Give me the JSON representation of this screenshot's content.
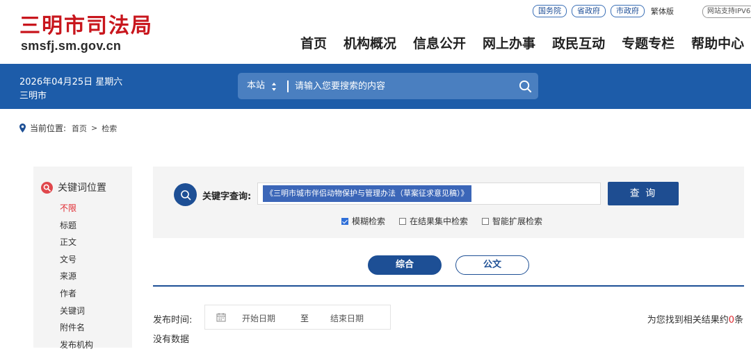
{
  "header": {
    "logo_title": "三明市司法局",
    "logo_domain": "smsfj.sm.gov.cn",
    "top_links": [
      "国务院",
      "省政府",
      "市政府"
    ],
    "traditional": "繁体版",
    "ipv6": "网站支持IPV6",
    "nav": [
      "首页",
      "机构概况",
      "信息公开",
      "网上办事",
      "政民互动",
      "专题专栏",
      "帮助中心"
    ]
  },
  "banner": {
    "date": "2026年04月25日 星期六",
    "city": "三明市",
    "scope": "本站",
    "search_placeholder": "请输入您要搜索的内容"
  },
  "breadcrumb": {
    "label": "当前位置:",
    "home": "首页",
    "separator": ">",
    "current": "检索"
  },
  "sidebar": {
    "title": "关键词位置",
    "items": [
      "不限",
      "标题",
      "正文",
      "文号",
      "来源",
      "作者",
      "关键词",
      "附件名",
      "发布机构"
    ],
    "active_index": 0
  },
  "query": {
    "label": "关键字查询:",
    "value": "《三明市城市伴侣动物保护与管理办法（草案征求意见稿）》",
    "button": "查 询",
    "options": [
      {
        "label": "模糊检索",
        "checked": true
      },
      {
        "label": "在结果集中检索",
        "checked": false
      },
      {
        "label": "智能扩展检索",
        "checked": false
      }
    ]
  },
  "tabs": [
    "综合",
    "公文"
  ],
  "filter": {
    "pub_label": "发布时间:",
    "start": "开始日期",
    "to": "至",
    "end": "结束日期"
  },
  "results": {
    "prefix": "为您找到相关结果约",
    "count": "0",
    "suffix": "条",
    "empty": "没有数据"
  },
  "colors": {
    "brand_red": "#c8161d",
    "banner_blue": "#1d5ca9",
    "dark_blue": "#1d4f95",
    "highlight": "#e0272e"
  }
}
